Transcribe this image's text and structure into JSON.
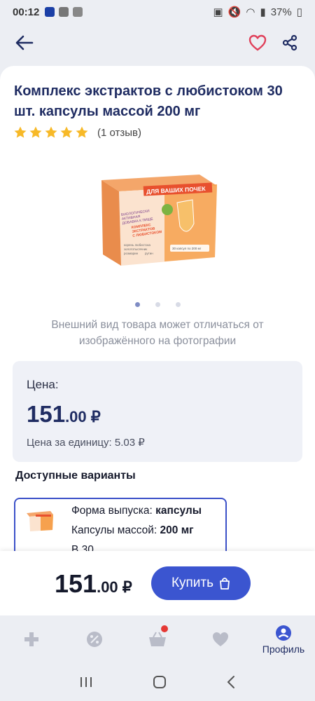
{
  "status_bar": {
    "time": "00:12",
    "battery": "37%"
  },
  "product": {
    "title": "Комплекс экстрактов с любистоком 30 шт. капсулы массой 200 мг",
    "rating": 5,
    "reviews": "(1 отзыв)",
    "image_count": 3,
    "active_image": 0,
    "disclaimer": "Внешний вид товара может отличаться от изображённого на фотографии"
  },
  "package_art": {
    "banner": "ДЛЯ ВАШИХ ПОЧЕК",
    "lines": [
      "БИОЛОГИЧЕСКИ",
      "АКТИВНАЯ",
      "ДОБАВКА К ПИЩЕ",
      "КОМПЛЕКС",
      "ЭКСТРАКТОВ",
      "С ЛЮБИСТОКОМ"
    ],
    "bullets": [
      "корень любистока",
      "золототысячник",
      "розмарин",
      "рутин"
    ],
    "capsules": "30 капсул по 200 мг"
  },
  "price_box": {
    "label": "Цена:",
    "price_int": "151",
    "price_frac": ".00 ₽",
    "unit_price": "Цена за единицу: 5.03 ₽"
  },
  "variants": {
    "title": "Доступные варианты",
    "form_label": "Форма выпуска:",
    "form_value": "капсулы",
    "mass_label": "Капсулы массой:",
    "mass_value": "200 мг",
    "partial_line": "В         30"
  },
  "buy_bar": {
    "price_int": "151",
    "price_frac": ".00 ₽",
    "button_label": "Купить"
  },
  "bottom_nav": {
    "profile_label": "Профиль"
  },
  "colors": {
    "brand": "#1f2c62",
    "accent": "#3b55d0",
    "heart": "#e0405a",
    "star": "#f7b928"
  }
}
